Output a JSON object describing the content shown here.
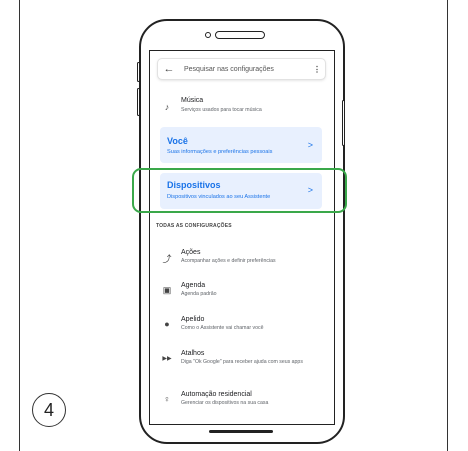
{
  "search": {
    "back_icon": "arrow-left-icon",
    "placeholder": "Pesquisar nas configurações",
    "more_icon": "more-vert-icon"
  },
  "music": {
    "title": "Música",
    "subtitle": "Serviços usados para tocar música",
    "icon": "music-note-icon"
  },
  "you_card": {
    "title": "Você",
    "subtitle": "Suas informações e preferências pessoais"
  },
  "devices_card": {
    "title": "Dispositivos",
    "subtitle": "Dispositivos vinculados ao seu Assistente"
  },
  "section_header": "TODAS AS CONFIGURAÇÕES",
  "settings": [
    {
      "title": "Ações",
      "subtitle": "Acompanhar ações e definir preferências",
      "icon": "trending-icon"
    },
    {
      "title": "Agenda",
      "subtitle": "Agenda padrão",
      "icon": "calendar-icon"
    },
    {
      "title": "Apelido",
      "subtitle": "Como o Assistente vai chamar você",
      "icon": "person-icon"
    },
    {
      "title": "Atalhos",
      "subtitle": "Diga \"Ok Google\" para receber ajuda com seus apps",
      "icon": "fast-forward-icon"
    },
    {
      "title": "Automação residencial",
      "subtitle": "Gerenciar os dispositivos na sua casa",
      "icon": "lightbulb-icon"
    }
  ],
  "chevron": ">",
  "step_number": "4",
  "colors": {
    "highlight": "#3aa84a",
    "card_bg": "#e8f0fe",
    "accent": "#1a73e8"
  }
}
